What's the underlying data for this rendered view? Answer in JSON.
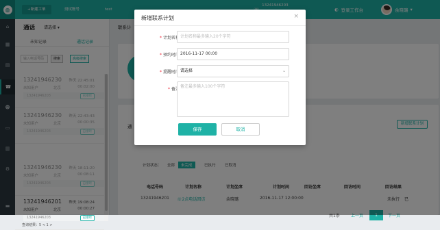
{
  "topbar": {
    "tabs": [
      "+新建工单",
      "测试账号",
      "test"
    ],
    "phone_number": "13241946203",
    "workbench": "登录工作台",
    "username": "余晓璐"
  },
  "calls_panel": {
    "title": "通话",
    "select": "请选择",
    "tabs": [
      "未知记录",
      "通话记录"
    ],
    "search_placeholder": "输入电话号码",
    "search_btn": "搜索",
    "adv_search_btn": "高级搜索",
    "items": [
      {
        "number": "13241946230",
        "when": "昨天 22:45:01",
        "sub": "未知用户",
        "city": "北京",
        "dur": "00:02:00",
        "phone": "13241946203",
        "badge": "已接听"
      },
      {
        "number": "13241946230",
        "when": "昨天 22:43:43",
        "sub": "未知用户",
        "city": "北京",
        "dur": "00:00:35",
        "phone": "13241946203",
        "badge": "已接听"
      },
      {
        "number": "13241946230",
        "when": "昨天 18:11:20",
        "sub": "未知用户",
        "city": "北京",
        "dur": "00:08:11",
        "phone": "13241946203",
        "badge": "已接听"
      },
      {
        "number": "13241946201",
        "when": "昨天 19:08:24",
        "sub": "未知用户",
        "city": "北京",
        "dur": "00:00:27",
        "phone": "13241946203",
        "badge": "已接听"
      }
    ],
    "footer": "查询结果：5      <  1  >"
  },
  "main": {
    "title": "联系计",
    "section_head": "通",
    "add_plan_btn": "新增联系计划",
    "filters": [
      "计划状态：",
      "全部",
      "未完成",
      "已执行",
      "已取消"
    ],
    "columns": [
      "电话号码",
      "计划名称",
      "计划坐席",
      "计划时间",
      "回访坐席",
      "回访时间",
      "回访结果"
    ],
    "row": {
      "phone": "13241946201",
      "name": "2点电话回访",
      "agent": "余晓璐",
      "time": "2016-11-17 12:00:00",
      "status": "未执行",
      "extra": "已"
    },
    "pager": {
      "total": "共1条",
      "prev": "上一页",
      "current": "1",
      "next": "下一页"
    }
  },
  "modal": {
    "title": "新增联系计划",
    "close": "×",
    "fields": {
      "plan_name": {
        "label": "计划名称:",
        "placeholder": "计划名称最多输入20个字符"
      },
      "appt_time": {
        "label": "预约时间:",
        "value": "2016-11-17 00:00"
      },
      "remind_time": {
        "label": "提醒时间:",
        "value": "请选择"
      },
      "note": {
        "label": "备注:",
        "placeholder": "备注最多输入100个字符"
      }
    },
    "save_label": "保存",
    "cancel_label": "取消"
  },
  "colors": {
    "accent": "#1fb2a6",
    "sidebar": "#2c3940",
    "required": "#e22233"
  },
  "icons": [
    "logo-icon",
    "home-icon",
    "grid-icon",
    "phone-icon",
    "user-icon",
    "chart-icon",
    "settings-icon",
    "headset-icon",
    "close-icon",
    "chevron-down-icon"
  ]
}
